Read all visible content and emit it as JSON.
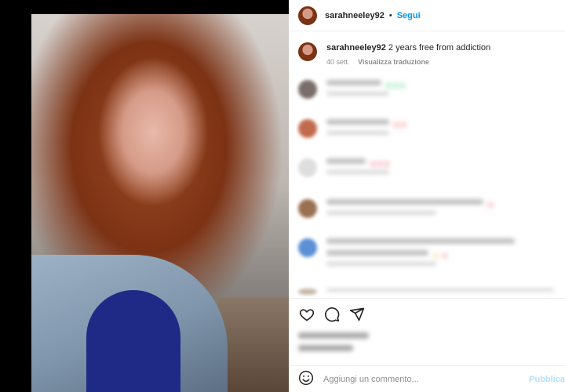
{
  "post": {
    "username": "sarahneeley92",
    "follow_label": "Segui",
    "caption_text": "2 years free from addiction",
    "age": "40 sett.",
    "translate_label": "Visualizza traduzione"
  },
  "actions": {
    "icons": [
      "heart-icon",
      "comment-icon",
      "share-icon"
    ]
  },
  "comment_input": {
    "placeholder": "Aggiungi un commento...",
    "publish_label": "Pubblica"
  },
  "colors": {
    "link_blue": "#0095f6",
    "publish_disabled": "#b2dffc"
  }
}
